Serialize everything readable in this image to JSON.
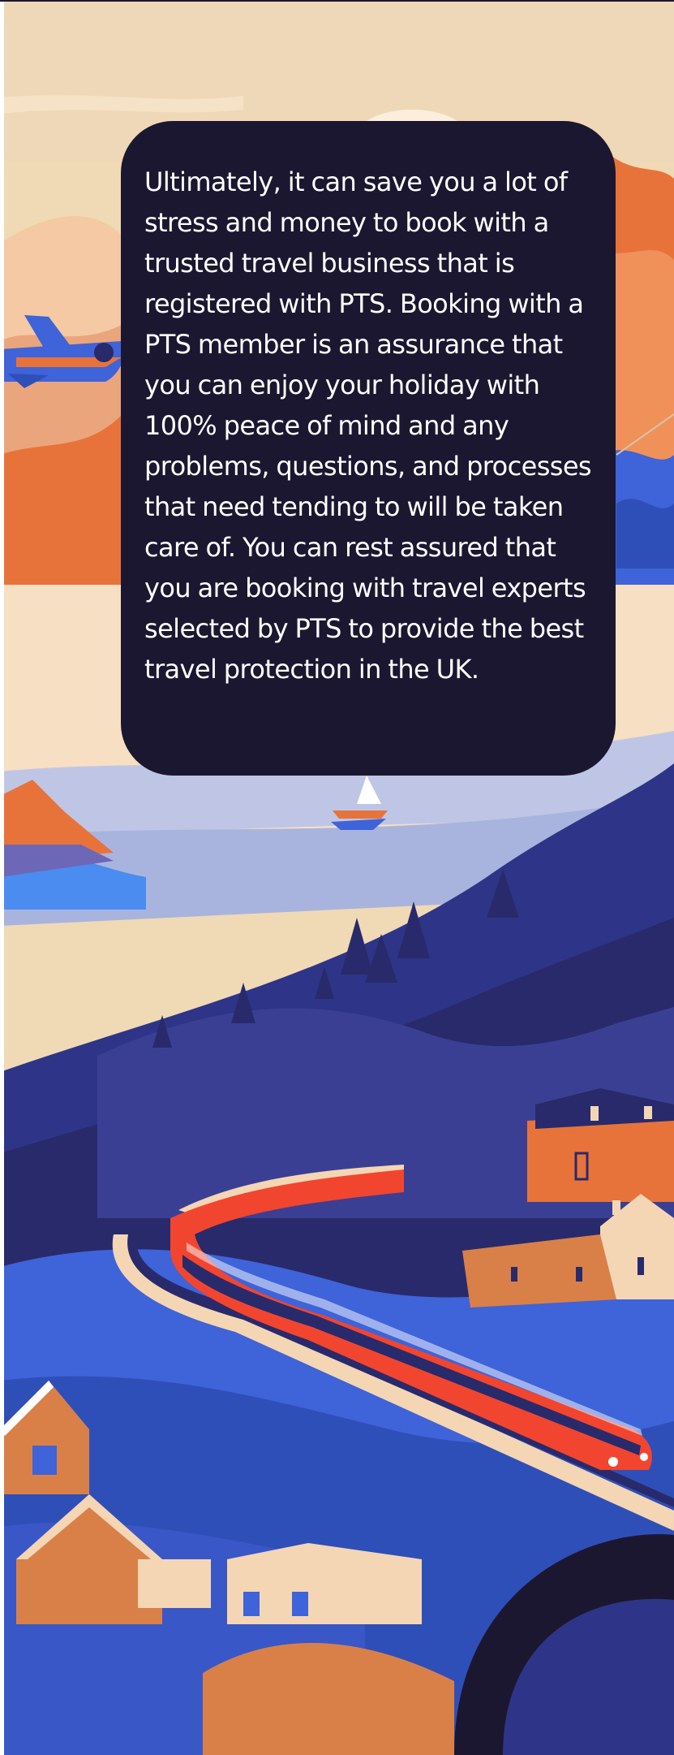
{
  "card": {
    "paragraph": "Ultimately, it can save you a lot of stress and money to book with a trusted travel business that is registered with PTS. Booking with a PTS member is an assurance that you can enjoy your holiday with 100% peace of mind and any problems, questions, and processes that need tending to will be taken care of. You can rest assured that you are booking with travel experts selected by PTS to provide the best travel protection in the UK."
  },
  "colors": {
    "card_background": "#1c1730",
    "card_text": "#ffffff",
    "sky_cream": "#f0d9b5",
    "orange": "#e8733a",
    "blue": "#3f63d8",
    "navy": "#282a6b",
    "train_red": "#f2452f"
  }
}
